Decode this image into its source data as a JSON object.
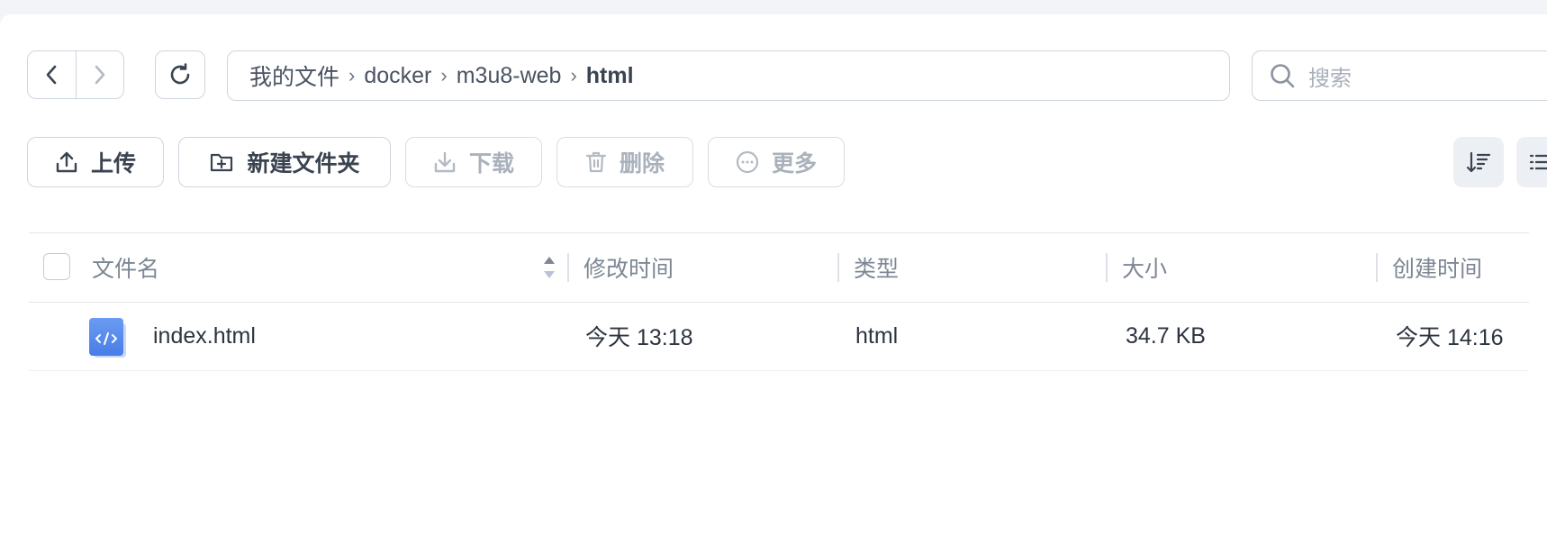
{
  "breadcrumb": {
    "items": [
      "我的文件",
      "docker",
      "m3u8-web"
    ],
    "current": "html",
    "separator": "›"
  },
  "search": {
    "placeholder": "搜索"
  },
  "toolbar": {
    "upload": "上传",
    "new_folder": "新建文件夹",
    "download": "下载",
    "delete": "删除",
    "more": "更多"
  },
  "table": {
    "headers": {
      "name": "文件名",
      "modified": "修改时间",
      "type": "类型",
      "size": "大小",
      "created": "创建时间"
    },
    "rows": [
      {
        "name": "index.html",
        "modified": "今天 13:18",
        "type": "html",
        "size": "34.7 KB",
        "created": "今天 14:16",
        "icon": "html-file-icon"
      }
    ]
  },
  "colors": {
    "accent": "#5b8def",
    "border": "#cfd5dd",
    "disabled_text": "#aab1bb",
    "header_text": "#7d8794"
  }
}
